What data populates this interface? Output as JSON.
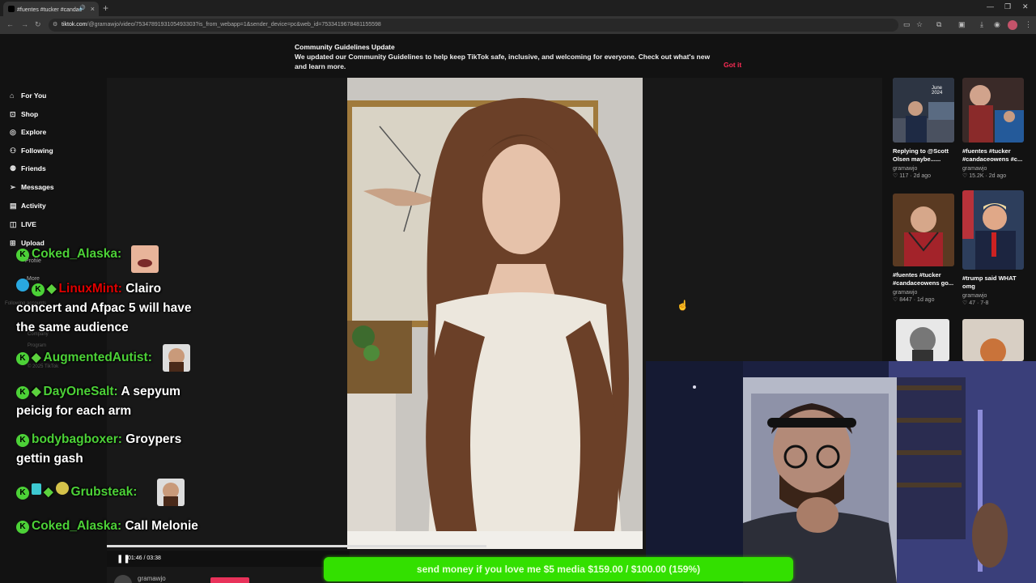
{
  "browser": {
    "tab_title": "#fuentes #tucker #candac",
    "url_host": "tiktok.com",
    "url_path": "/@gramawjo/video/7534789193105493303?is_from_webapp=1&sender_device=pc&web_id=7533419678481155598"
  },
  "banner": {
    "title": "Community Guidelines Update",
    "body": "We updated our Community Guidelines to help keep TikTok safe, inclusive, and welcoming for everyone. Check out what's new and learn more.",
    "action": "Got it"
  },
  "sidebar": {
    "items": [
      {
        "label": "For You",
        "icon": "home-icon"
      },
      {
        "label": "Shop",
        "icon": "shop-icon"
      },
      {
        "label": "Explore",
        "icon": "compass-icon"
      },
      {
        "label": "Following",
        "icon": "following-icon"
      },
      {
        "label": "Friends",
        "icon": "friends-icon"
      },
      {
        "label": "Messages",
        "icon": "send-icon"
      },
      {
        "label": "Activity",
        "icon": "activity-icon"
      },
      {
        "label": "LIVE",
        "icon": "live-icon"
      },
      {
        "label": "Upload",
        "icon": "upload-icon"
      }
    ],
    "profile": "Profile",
    "more": "More",
    "following_accounts": "Following accounts",
    "company": "Company",
    "program": "Program",
    "copyright": "© 2025 TikTok"
  },
  "player": {
    "time": "01:46 / 03:38",
    "progress": 0.49,
    "author": "gramawjo"
  },
  "recommendations": [
    {
      "caption": "Replying to @Scott Olsen maybe......",
      "author": "gramawjo",
      "likes": "117",
      "age": "2d ago",
      "badge": "June 2024"
    },
    {
      "caption": "#fuentes #tucker #candaceowens #c...",
      "author": "gramawjo",
      "likes": "15.2K",
      "age": "2d ago"
    },
    {
      "caption": "#fuentes #tucker #candaceowens go...",
      "author": "gramawjo",
      "likes": "8447",
      "age": "1d ago"
    },
    {
      "caption": "#trump said WHAT omg",
      "author": "gramawjo",
      "likes": "47",
      "age": "7-8"
    }
  ],
  "chat": [
    {
      "user": "Coked_Alaska:",
      "text": ""
    },
    {
      "user": "LinuxMint:",
      "text": "Clairo concert and Afpac 5 will have the same audience"
    },
    {
      "user": "AugmentedAutist:",
      "text": ""
    },
    {
      "user": "DayOneSalt:",
      "text": "A sepyum peicig for each arm"
    },
    {
      "user": "bodybagboxer:",
      "text": "Groypers gettin gash"
    },
    {
      "user": "Grubsteak:",
      "text": ""
    },
    {
      "user": "Coked_Alaska:",
      "text": "Call Melonie"
    }
  ],
  "donation": {
    "text": "send money if you love me $5 media $159.00 / $100.00 (159%)"
  }
}
